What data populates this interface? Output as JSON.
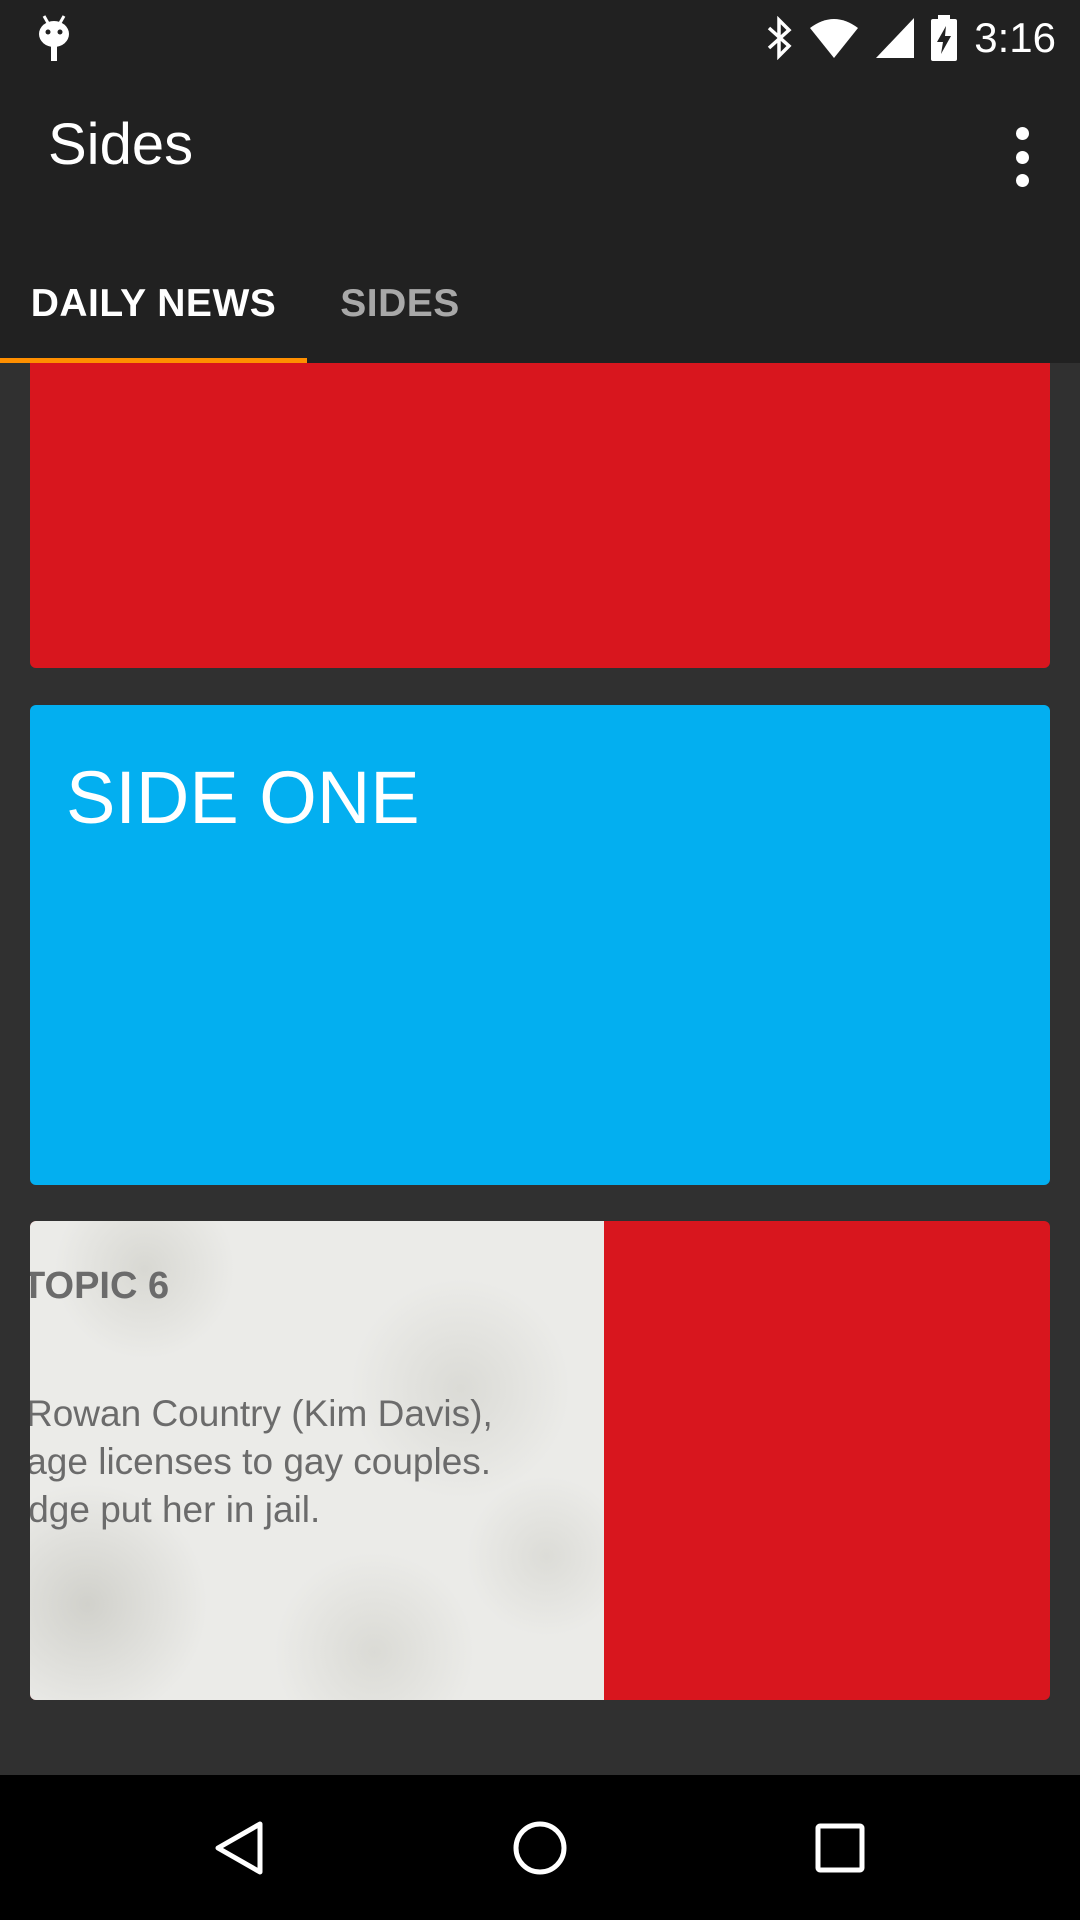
{
  "status_bar": {
    "time": "3:16",
    "icons": [
      "android-icon",
      "bluetooth-icon",
      "wifi-icon",
      "signal-icon",
      "battery-charging-icon"
    ]
  },
  "app_bar": {
    "title": "Sides",
    "overflow_icon": "more-vert-icon"
  },
  "tabs": [
    {
      "label": "DAILY NEWS",
      "selected": true
    },
    {
      "label": "SIDES",
      "selected": false
    }
  ],
  "colors": {
    "background": "#303030",
    "toolbar": "#212121",
    "tab_indicator": "#ff8f00",
    "card_red": "#d8161e",
    "card_blue": "#03aff0"
  },
  "cards": {
    "side_one": {
      "title": "SIDE ONE"
    },
    "topic": {
      "heading": "TOPIC 6",
      "lines": [
        "Rowan Country (Kim Davis),",
        "iage licenses to gay couples.",
        "idge put her in jail."
      ]
    }
  },
  "nav_bar": {
    "back_icon": "back-icon",
    "home_icon": "home-icon",
    "recents_icon": "recents-icon"
  }
}
